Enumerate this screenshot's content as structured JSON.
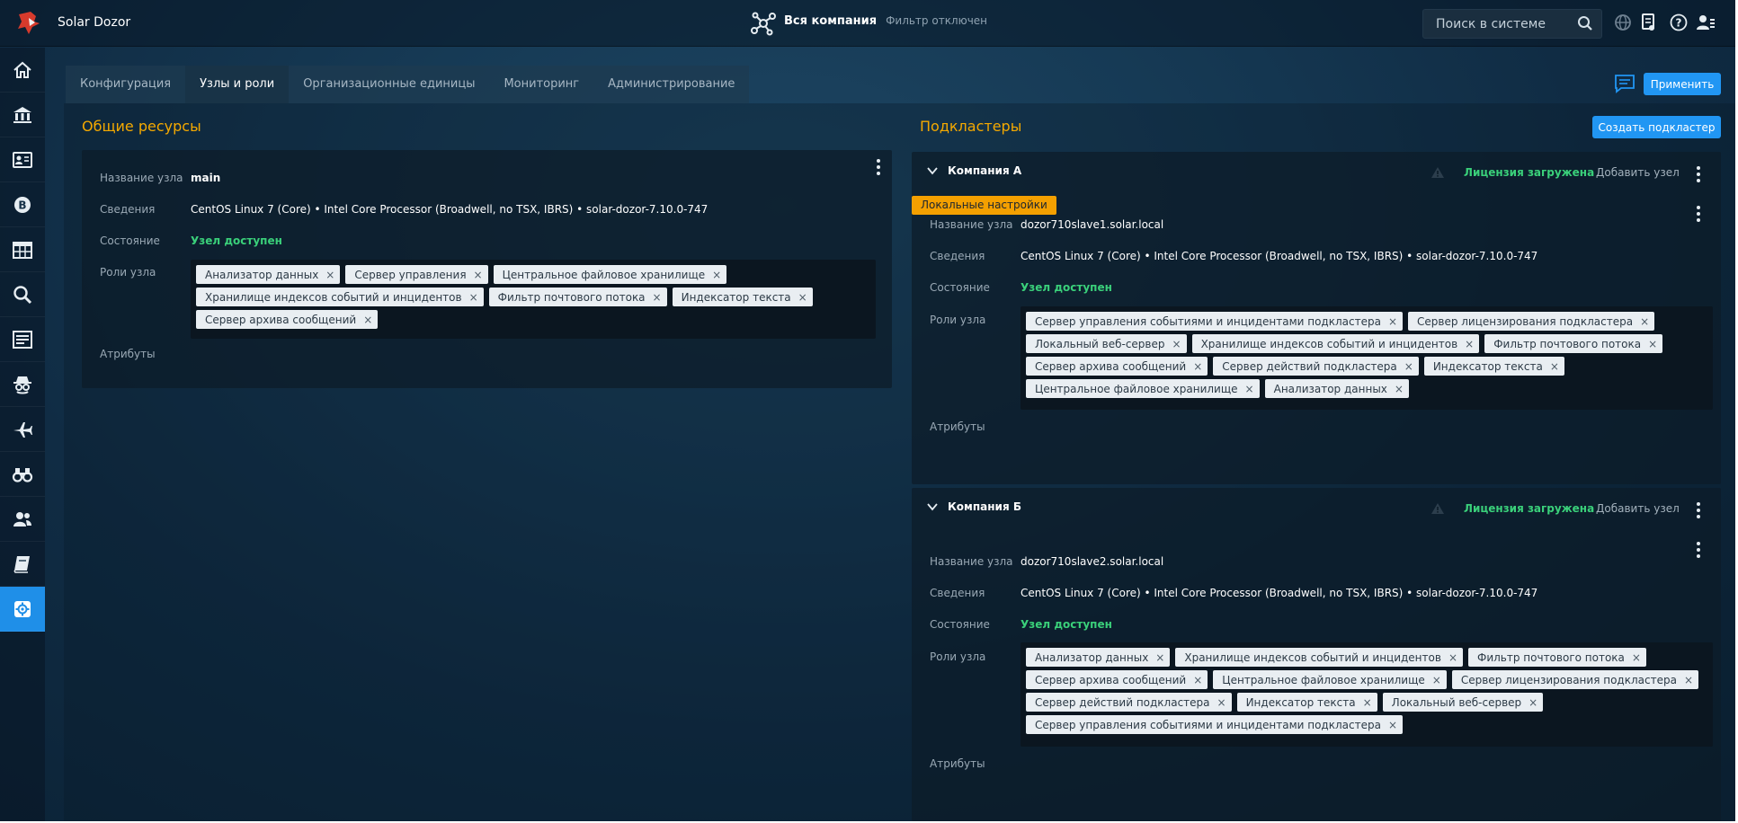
{
  "app": {
    "title": "Solar Dozor"
  },
  "header": {
    "scope_name": "Вся компания",
    "scope_filter": "Фильтр отключен",
    "search_placeholder": "Поиск в системе"
  },
  "tabs": [
    {
      "label": "Конфигурация"
    },
    {
      "label": "Узлы и роли",
      "active": true
    },
    {
      "label": "Организационные единицы"
    },
    {
      "label": "Мониторинг"
    },
    {
      "label": "Администрирование"
    }
  ],
  "toolbar": {
    "apply_label": "Применить"
  },
  "shared": {
    "title": "Общие ресурсы",
    "node": {
      "name_label": "Название узла",
      "name": "main",
      "info_label": "Сведения",
      "info": "CentOS Linux 7 (Core) • Intel Core Processor (Broadwell, no TSX, IBRS) • solar-dozor-7.10.0-747",
      "state_label": "Состояние",
      "state": "Узел доступен",
      "roles_label": "Роли узла",
      "roles": [
        "Анализатор данных",
        "Сервер управления",
        "Центральное файловое хранилище",
        "Хранилище индексов событий и инцидентов",
        "Фильтр почтового потока",
        "Индексатор текста",
        "Сервер архива сообщений"
      ],
      "attrs_label": "Атрибуты"
    }
  },
  "subclusters": {
    "title": "Подкластеры",
    "create_label": "Создать подкластер",
    "items": [
      {
        "company": "Компания А",
        "license": "Лицензия загружена",
        "add_node": "Добавить узел",
        "badge": "Локальные настройки",
        "name_label": "Название узла",
        "name": "dozor710slave1.solar.local",
        "info_label": "Сведения",
        "info": "CentOS Linux 7 (Core) • Intel Core Processor (Broadwell, no TSX, IBRS) • solar-dozor-7.10.0-747",
        "state_label": "Состояние",
        "state": "Узел доступен",
        "roles_label": "Роли узла",
        "roles": [
          "Сервер управления событиями и инцидентами подкластера",
          "Сервер лицензирования подкластера",
          "Локальный веб-сервер",
          "Хранилище индексов событий и инцидентов",
          "Фильтр почтового потока",
          "Сервер архива сообщений",
          "Сервер действий подкластера",
          "Индексатор текста",
          "Центральное файловое хранилище",
          "Анализатор данных"
        ],
        "attrs_label": "Атрибуты"
      },
      {
        "company": "Компания Б",
        "license": "Лицензия загружена",
        "add_node": "Добавить узел",
        "name_label": "Название узла",
        "name": "dozor710slave2.solar.local",
        "info_label": "Сведения",
        "info": "CentOS Linux 7 (Core) • Intel Core Processor (Broadwell, no TSX, IBRS) • solar-dozor-7.10.0-747",
        "state_label": "Состояние",
        "state": "Узел доступен",
        "roles_label": "Роли узла",
        "roles": [
          "Анализатор данных",
          "Хранилище индексов событий и инцидентов",
          "Фильтр почтового потока",
          "Сервер архива сообщений",
          "Центральное файловое хранилище",
          "Сервер лицензирования подкластера",
          "Сервер действий подкластера",
          "Индексатор текста",
          "Локальный веб-сервер",
          "Сервер управления событиями и инцидентами подкластера"
        ],
        "attrs_label": "Атрибуты"
      }
    ]
  },
  "sidebar": [
    {
      "icon": "home-icon"
    },
    {
      "icon": "bank-icon"
    },
    {
      "icon": "person-card-icon"
    },
    {
      "icon": "bitcoin-icon"
    },
    {
      "icon": "calendar-grid-icon"
    },
    {
      "icon": "search-icon"
    },
    {
      "icon": "list-icon"
    },
    {
      "icon": "spy-icon"
    },
    {
      "icon": "airplane-icon"
    },
    {
      "icon": "binoculars-icon"
    },
    {
      "icon": "users-icon"
    },
    {
      "icon": "book-icon"
    },
    {
      "icon": "gear-icon",
      "active": true
    }
  ],
  "colors": {
    "accent": "#2196f3",
    "title": "#f4a900",
    "status_ok": "#3ad07a",
    "badge": "#f4a000"
  }
}
